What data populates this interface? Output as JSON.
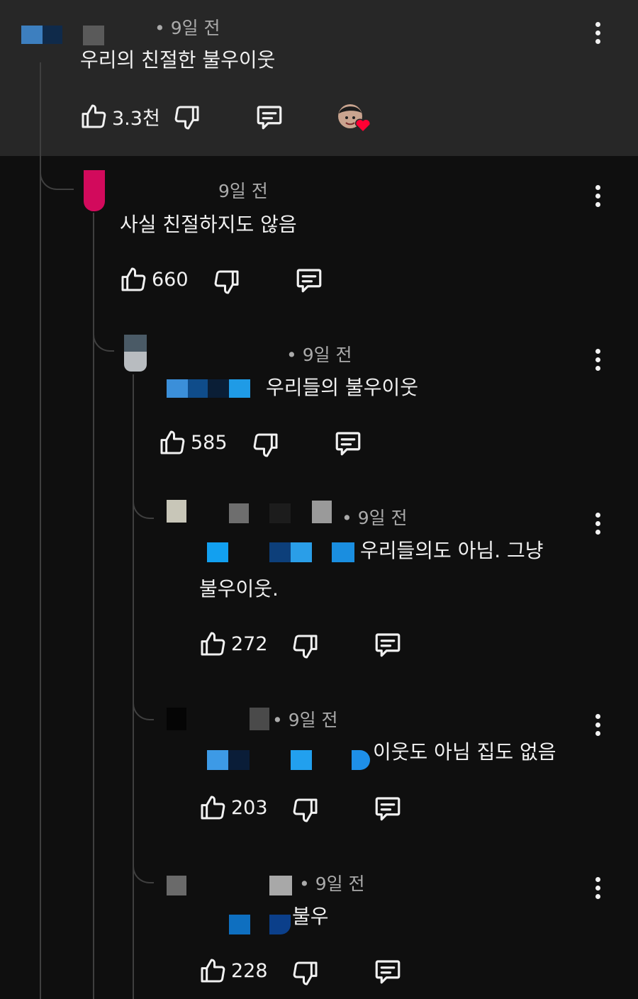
{
  "comments": [
    {
      "time": "• 9일 전",
      "text": "우리의 친절한 불우이웃",
      "likes": "3.3천"
    },
    {
      "time": "9일 전",
      "text": "사실 친절하지도 않음",
      "likes": "660"
    },
    {
      "time": "• 9일 전",
      "text": "우리들의 불우이웃",
      "likes": "585"
    },
    {
      "time": "• 9일 전",
      "text": "우리들의도 아님. 그냥",
      "text2": "불우이웃.",
      "likes": "272"
    },
    {
      "time": "• 9일 전",
      "text": "이웃도 아님 집도 없음",
      "likes": "203"
    },
    {
      "time": "• 9일 전",
      "text": "불우",
      "likes": "228"
    }
  ],
  "icons": {
    "like": "thumbs-up-icon",
    "dislike": "thumbs-down-icon",
    "reply": "reply-icon",
    "more": "more-vert-icon",
    "creator_heart": "creator-heart-icon"
  },
  "colors": {
    "background": "#0f0f0f",
    "highlight": "#272727",
    "text": "#f1f1f1",
    "secondary": "#aaaaaa",
    "heart": "#ff0033"
  }
}
